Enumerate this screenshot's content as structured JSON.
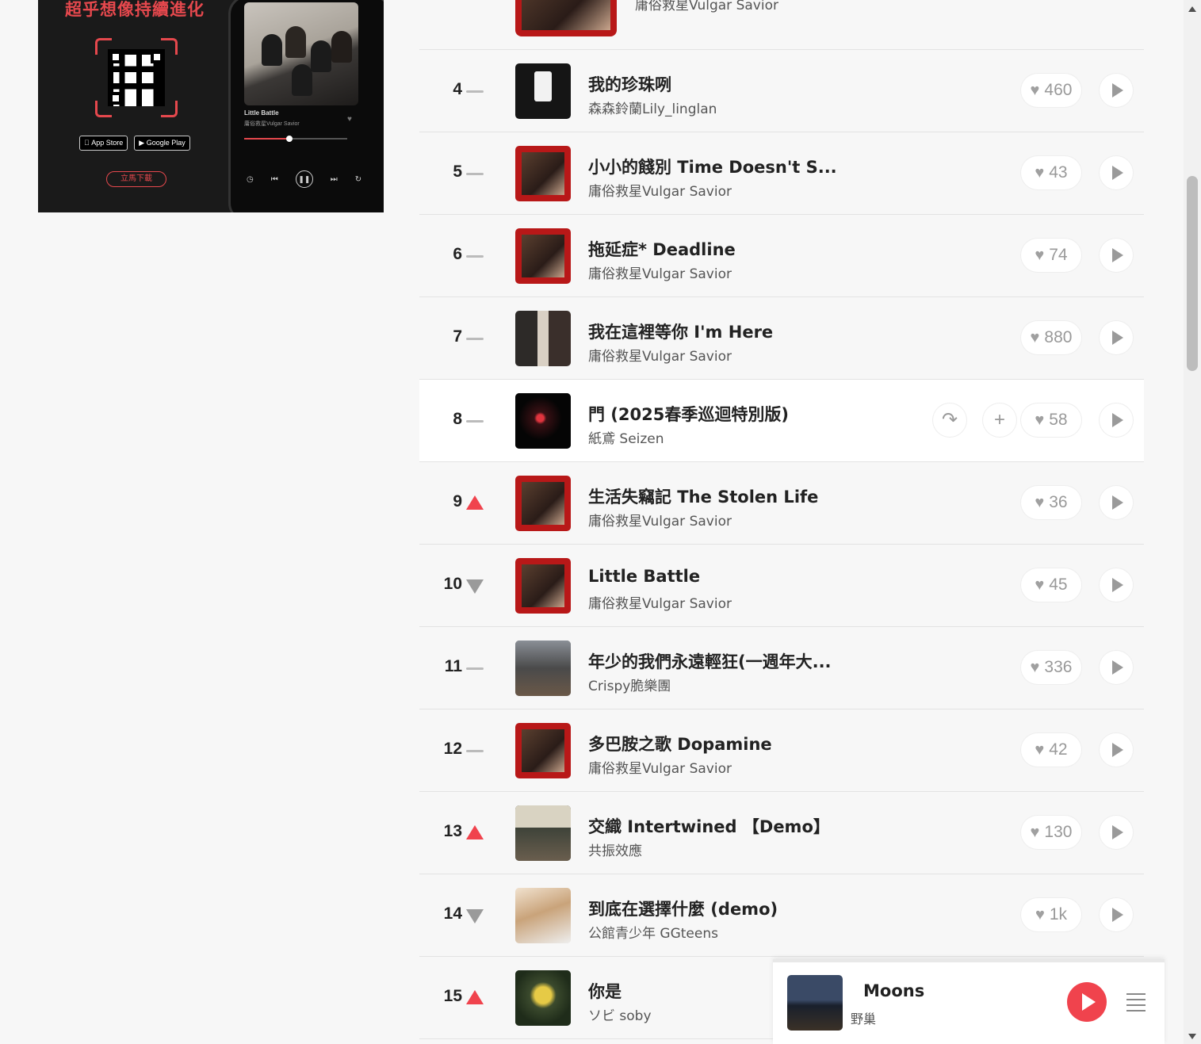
{
  "promo": {
    "headline": "超乎想像持續進化",
    "app_store": "App Store",
    "google_play": "Google Play",
    "download": "立馬下載",
    "phone_track": "Little Battle",
    "phone_artist": "庸俗救星Vulgar Savior"
  },
  "prev_row_artist": "庸俗救星Vulgar Savior",
  "tracks": [
    {
      "rank": "4",
      "trend": "same",
      "title": "我的珍珠咧",
      "artist": "森森鈴蘭Lily_linglan",
      "likes": "460",
      "cover": "boba"
    },
    {
      "rank": "5",
      "trend": "same",
      "title": "小小的餞別 Time Doesn't S...",
      "artist": "庸俗救星Vulgar Savior",
      "likes": "43",
      "cover": "band"
    },
    {
      "rank": "6",
      "trend": "same",
      "title": "拖延症* Deadline",
      "artist": "庸俗救星Vulgar Savior",
      "likes": "74",
      "cover": "band"
    },
    {
      "rank": "7",
      "trend": "same",
      "title": "我在這裡等你 I'm Here",
      "artist": "庸俗救星Vulgar Savior",
      "likes": "880",
      "cover": "duo"
    },
    {
      "rank": "8",
      "trend": "same",
      "title": "門 (2025春季巡迴特別版)",
      "artist": "紙鳶 Seizen",
      "likes": "58",
      "cover": "dark"
    },
    {
      "rank": "9",
      "trend": "up",
      "title": "生活失竊記 The Stolen Life",
      "artist": "庸俗救星Vulgar Savior",
      "likes": "36",
      "cover": "band"
    },
    {
      "rank": "10",
      "trend": "down",
      "title": "Little Battle",
      "artist": "庸俗救星Vulgar Savior",
      "likes": "45",
      "cover": "band"
    },
    {
      "rank": "11",
      "trend": "same",
      "title": "年少的我們永遠輕狂(一週年大...",
      "artist": "Crispy脆樂團",
      "likes": "336",
      "cover": "grey"
    },
    {
      "rank": "12",
      "trend": "same",
      "title": "多巴胺之歌 Dopamine",
      "artist": "庸俗救星Vulgar Savior",
      "likes": "42",
      "cover": "band"
    },
    {
      "rank": "13",
      "trend": "up",
      "title": "交織 Intertwined 【Demo】",
      "artist": "共振效應",
      "likes": "130",
      "cover": "room"
    },
    {
      "rank": "14",
      "trend": "down",
      "title": "到底在選擇什麼 (demo)",
      "artist": "公館青少年 GGteens",
      "likes": "1k",
      "cover": "photo"
    },
    {
      "rank": "15",
      "trend": "up",
      "title": "你是",
      "artist": "ソビ soby",
      "likes": "",
      "cover": "field"
    }
  ],
  "hover_actions": {
    "share_icon": "↷",
    "add_icon": "+"
  },
  "player": {
    "title": "Moons",
    "artist": "野巢",
    "progress": 0.0
  },
  "colors": {
    "accent": "#f0434d"
  }
}
